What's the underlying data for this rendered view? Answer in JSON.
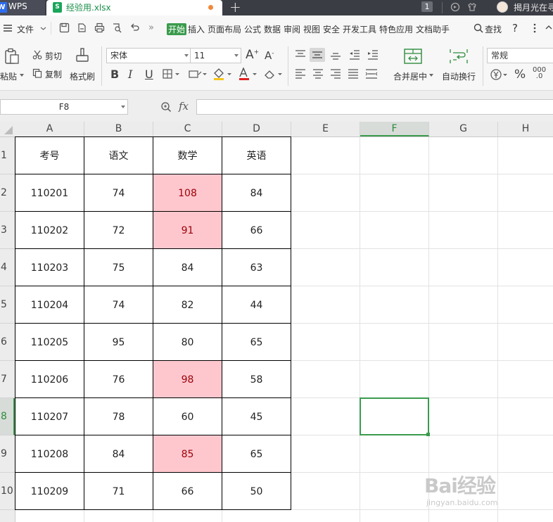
{
  "titlebar": {
    "wps_tab": "WPS",
    "file_tab": "经验用.xlsx",
    "add_tab": "+",
    "badge": "1",
    "user": "揭月光在寻"
  },
  "menu": {
    "file": "文件",
    "items": [
      "开始",
      "插入",
      "页面布局",
      "公式",
      "数据",
      "审阅",
      "视图",
      "安全",
      "开发工具",
      "特色应用",
      "文档助手"
    ],
    "search": "查找",
    "help": "?"
  },
  "ribbon": {
    "paste": "粘贴",
    "cut": "剪切",
    "copy": "复制",
    "format_painter": "格式刷",
    "font_name": "宋体",
    "font_size": "11",
    "bold": "B",
    "italic": "I",
    "underline": "U",
    "merge_center": "合并居中",
    "wrap_text": "自动换行",
    "number_format": "常规",
    "percent": "%"
  },
  "formula_bar": {
    "name_box": "F8",
    "fx": "fx",
    "formula": ""
  },
  "sheet": {
    "columns": [
      "A",
      "B",
      "C",
      "D",
      "E",
      "F",
      "G",
      "H"
    ],
    "selected_column": "F",
    "rows": [
      "1",
      "2",
      "3",
      "4",
      "5",
      "6",
      "7",
      "8",
      "9",
      "10"
    ],
    "selected_row": "8",
    "header_row": [
      "考号",
      "语文",
      "数学",
      "英语"
    ],
    "data": [
      [
        "110201",
        "74",
        "108",
        "84"
      ],
      [
        "110202",
        "72",
        "91",
        "66"
      ],
      [
        "110203",
        "75",
        "84",
        "63"
      ],
      [
        "110204",
        "74",
        "82",
        "44"
      ],
      [
        "110205",
        "95",
        "80",
        "65"
      ],
      [
        "110206",
        "76",
        "98",
        "58"
      ],
      [
        "110207",
        "78",
        "60",
        "45"
      ],
      [
        "110208",
        "84",
        "85",
        "65"
      ],
      [
        "110209",
        "71",
        "66",
        "50"
      ]
    ],
    "highlighted_math_rows": [
      0,
      1,
      5,
      7
    ],
    "highlight_fill": "#fec7ce",
    "highlight_text": "#9c0006",
    "accent": "#3a9b4c"
  },
  "watermark": {
    "text": "Bai经验",
    "url": "jingyan.baidu.com"
  }
}
